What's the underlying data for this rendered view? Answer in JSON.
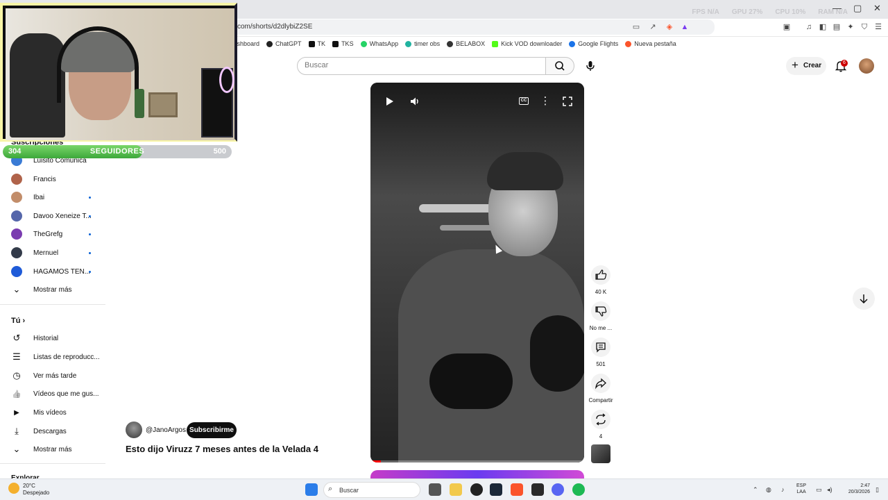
{
  "window": {
    "stats": [
      "FPS N/A",
      "GPU 27%",
      "CPU 10%",
      "RAM N/A"
    ],
    "minimize": "—",
    "maximize": "▢",
    "close": "✕"
  },
  "browser": {
    "url": "com/shorts/d2dlybiZ2SE",
    "bookmarks": [
      {
        "label": "Dashboard",
        "color": "#6b6b6b"
      },
      {
        "label": "ChatGPT",
        "color": "#222222"
      },
      {
        "label": "TK",
        "color": "#111111"
      },
      {
        "label": "TKS",
        "color": "#111111"
      },
      {
        "label": "WhatsApp",
        "color": "#25d366"
      },
      {
        "label": "timer obs",
        "color": "#20b3a0"
      },
      {
        "label": "BELABOX",
        "color": "#333333"
      },
      {
        "label": "Kick VOD downloader",
        "color": "#53fc18"
      },
      {
        "label": "Google Flights",
        "color": "#1a73e8"
      },
      {
        "label": "Nueva pestaña",
        "color": "#fb542b"
      }
    ]
  },
  "overlay": {
    "followers_current": "304",
    "followers_label": "SEGUIDORES",
    "followers_goal": "500",
    "followers_progress": 0.608
  },
  "sidebar": {
    "subscriptions_heading": "Suscripciones",
    "subscriptions": [
      {
        "label": "Luisito Comunica",
        "color": "#3a7bd5",
        "dot": false
      },
      {
        "label": "Francis",
        "color": "#b0634a",
        "dot": false
      },
      {
        "label": "Ibai",
        "color": "#c28d6a",
        "dot": true
      },
      {
        "label": "Davoo Xeneize T...",
        "color": "#5566aa",
        "dot": true
      },
      {
        "label": "TheGrefg",
        "color": "#7a3cb0",
        "dot": true
      },
      {
        "label": "Mernuel",
        "color": "#333b4a",
        "dot": true
      },
      {
        "label": "HAGAMOS TEN...",
        "color": "#1f5bd8",
        "dot": true
      }
    ],
    "show_more_1": "Mostrar más",
    "you_heading": "Tú",
    "you_items": [
      {
        "label": "Historial",
        "icon": "history-icon",
        "glyph": "↺"
      },
      {
        "label": "Listas de reproducc...",
        "icon": "playlists-icon",
        "glyph": "☰"
      },
      {
        "label": "Ver más tarde",
        "icon": "watch-later-icon",
        "glyph": "◷"
      },
      {
        "label": "Vídeos que me gus...",
        "icon": "liked-videos-icon",
        "glyph": "👍"
      },
      {
        "label": "Mis vídeos",
        "icon": "my-videos-icon",
        "glyph": "▶"
      },
      {
        "label": "Descargas",
        "icon": "downloads-icon",
        "glyph": "⤓"
      }
    ],
    "show_more_2": "Mostrar más",
    "explore_heading": "Explorar"
  },
  "header": {
    "search_placeholder": "Buscar",
    "create_label": "Crear",
    "notifications_count": "6"
  },
  "short": {
    "channel": "@JanoArgos",
    "subscribe_label": "Subscribirme",
    "title": "Esto dijo Viruzz 7 meses antes de la Velada 4",
    "progress": 0.05,
    "likes": "40 K",
    "dislike_label": "No me ...",
    "comments": "501",
    "share_label": "Compartir",
    "remix": "4"
  },
  "taskbar": {
    "temperature": "20°C",
    "weather": "Despejado",
    "search_label": "Buscar",
    "lang_1": "ESP",
    "lang_2": "LAA",
    "time": "2:47",
    "date": "20/3/2026"
  }
}
